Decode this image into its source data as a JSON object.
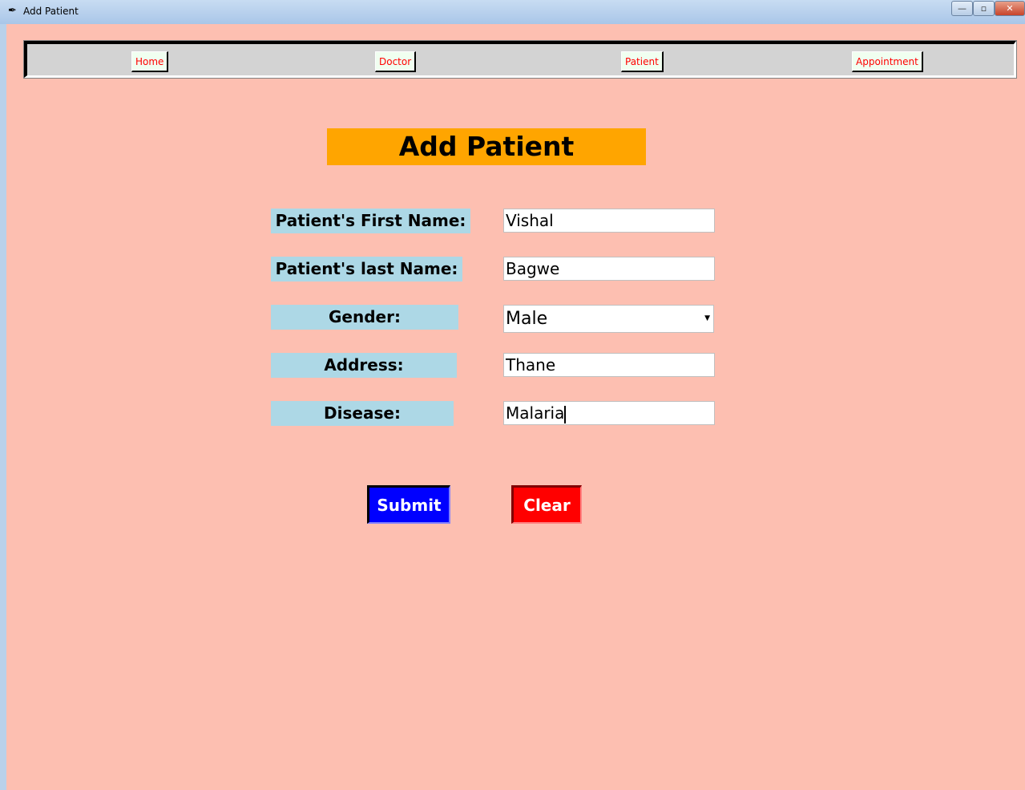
{
  "window": {
    "title": "Add Patient",
    "minimize": "—",
    "maximize": "▫",
    "close": "✕"
  },
  "nav": {
    "home": "Home",
    "doctor": "Doctor",
    "patient": "Patient",
    "appointment": "Appointment"
  },
  "heading": "Add Patient",
  "form": {
    "first_name": {
      "label": "Patient's First Name:",
      "value": "Vishal"
    },
    "last_name": {
      "label": "Patient's last Name:",
      "value": "Bagwe"
    },
    "gender": {
      "label": "Gender:",
      "value": "Male"
    },
    "address": {
      "label": "Address:",
      "value": "Thane"
    },
    "disease": {
      "label": "Disease:",
      "value": "Malaria"
    }
  },
  "buttons": {
    "submit": "Submit",
    "clear": "Clear"
  },
  "colors": {
    "background": "#fdbfb1",
    "heading": "#ffa500",
    "label": "#add8e6",
    "submit": "#0000ff",
    "clear": "#ff0000"
  }
}
